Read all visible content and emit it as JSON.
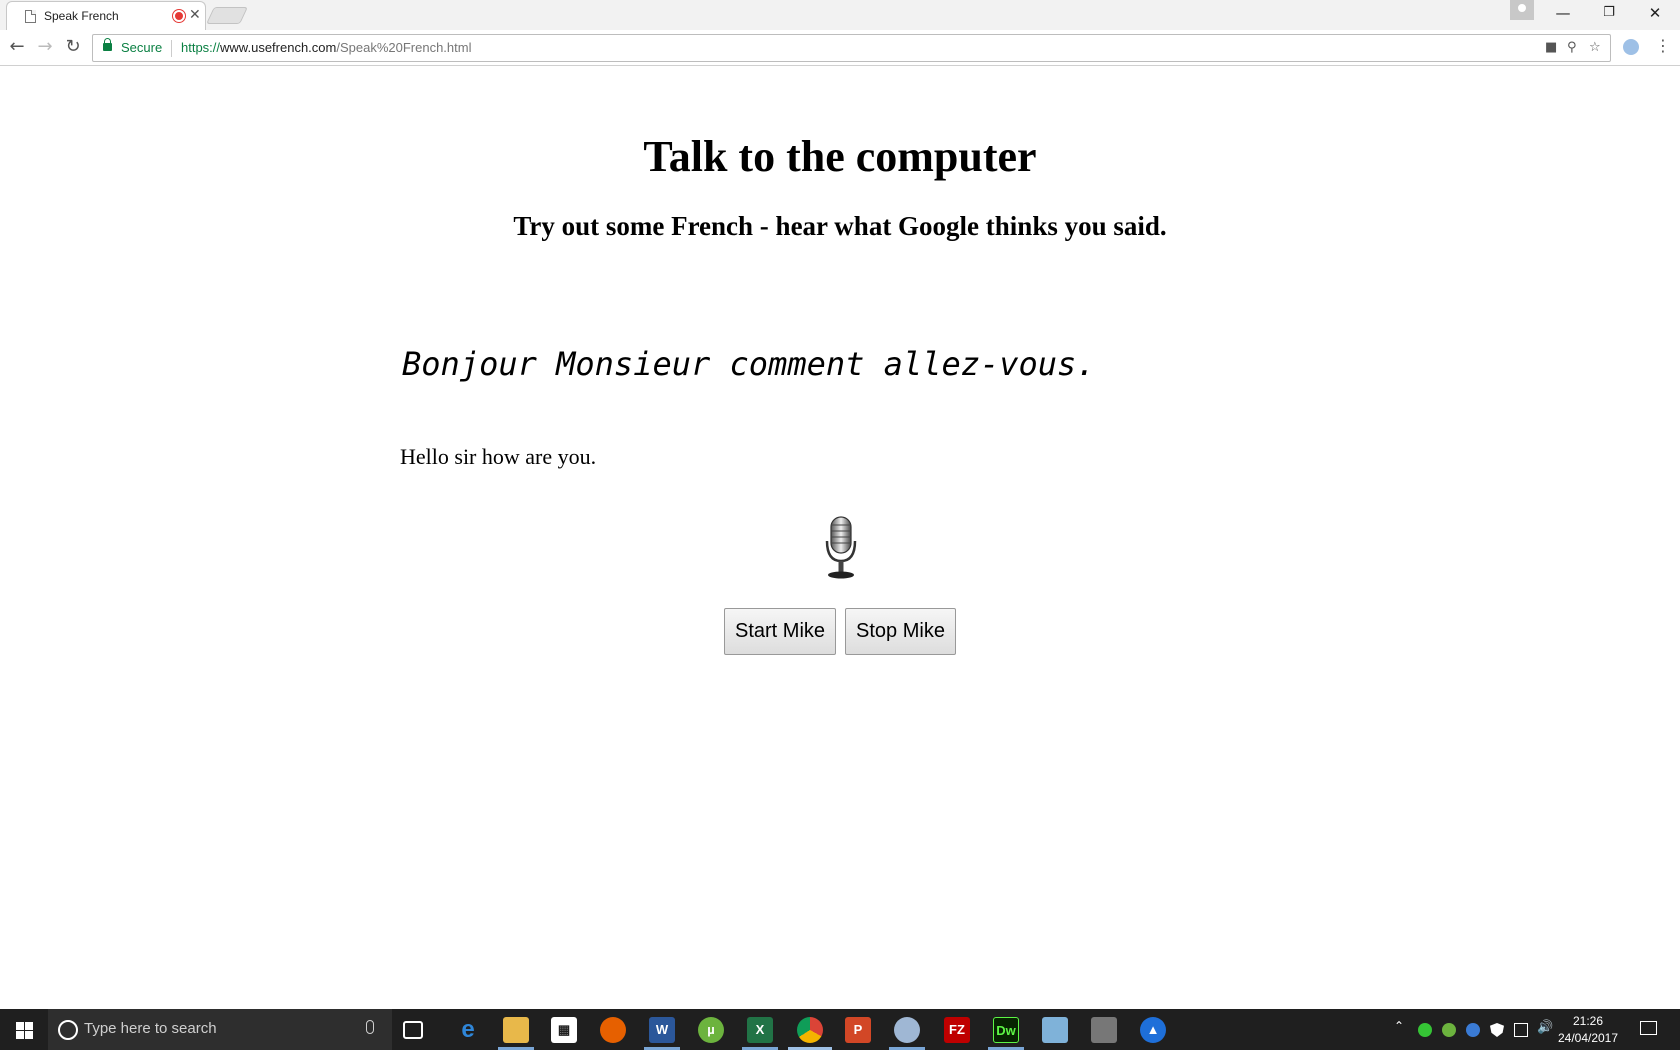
{
  "browser": {
    "tab_title": "Speak French",
    "secure_label": "Secure",
    "url_scheme": "https://",
    "url_host": "www.usefrench.com",
    "url_path": "/Speak%20French.html"
  },
  "page": {
    "heading": "Talk to the computer",
    "subheading": "Try out some French - hear what Google thinks you said.",
    "french_text": "Bonjour Monsieur comment allez-vous.",
    "english_text": "Hello sir how are you.",
    "start_button": "Start Mike",
    "stop_button": "Stop Mike",
    "mic_icon": "microphone-icon"
  },
  "taskbar": {
    "search_placeholder": "Type here to search",
    "time": "21:26",
    "date": "24/04/2017",
    "apps": [
      "task-view",
      "edge",
      "file-explorer",
      "store",
      "firefox",
      "word",
      "utorrent",
      "excel",
      "chrome",
      "powerpoint",
      "paint",
      "filezilla",
      "dreamweaver",
      "notepad",
      "tool",
      "app"
    ]
  },
  "colors": {
    "secure_green": "#0b8043",
    "taskbar_bg": "#1f1f1f"
  }
}
